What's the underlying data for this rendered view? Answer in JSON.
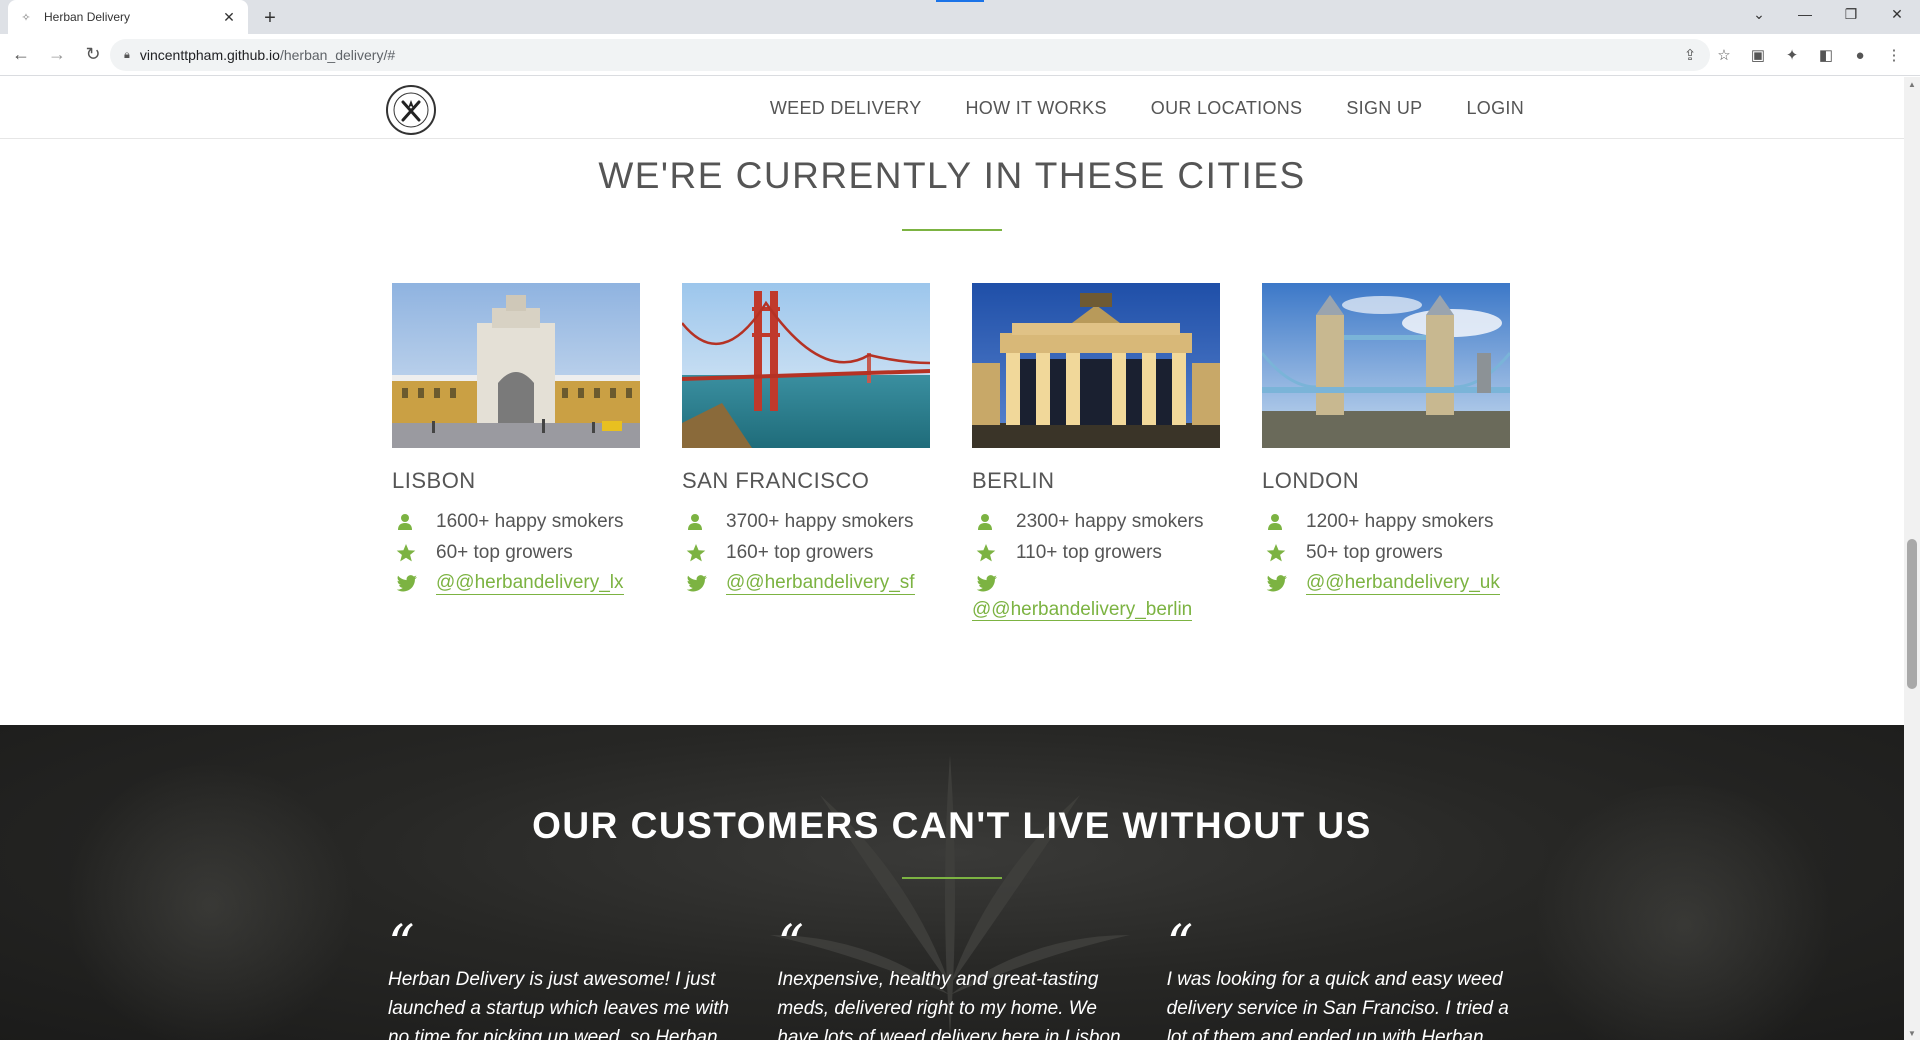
{
  "browser": {
    "tab_title": "Herban Delivery",
    "url_host": "vincenttpham.github.io",
    "url_path": "/herban_delivery/#"
  },
  "nav": {
    "links": [
      "WEED DELIVERY",
      "HOW IT WORKS",
      "OUR LOCATIONS",
      "SIGN UP",
      "LOGIN"
    ]
  },
  "cities_section": {
    "title": "WE'RE CURRENTLY IN THESE CITIES",
    "cities": [
      {
        "name": "LISBON",
        "smokers": "1600+ happy smokers",
        "growers": "60+ top growers",
        "twitter": "@@herbandelivery_lx"
      },
      {
        "name": "SAN FRANCISCO",
        "smokers": "3700+ happy smokers",
        "growers": "160+ top growers",
        "twitter": "@@herbandelivery_sf"
      },
      {
        "name": "BERLIN",
        "smokers": "2300+ happy smokers",
        "growers": "110+ top growers",
        "twitter": "@@herbandelivery_berlin"
      },
      {
        "name": "LONDON",
        "smokers": "1200+ happy smokers",
        "growers": "50+ top growers",
        "twitter": "@@herbandelivery_uk"
      }
    ]
  },
  "testimonials": {
    "title": "OUR CUSTOMERS CAN'T LIVE WITHOUT US",
    "quote_mark": "“",
    "quotes": [
      "Herban Delivery is just awesome! I just launched a startup which leaves me with no time for picking up weed, so Herban Delivery",
      "Inexpensive, healthy and great-tasting meds, delivered right to my home. We have lots of weed delivery here in Lisbon, but no one",
      "I was looking for a quick and easy weed delivery service in San Franciso. I tried a lot of them and ended up with Herban Delivery"
    ]
  },
  "colors": {
    "accent": "#7cb342",
    "text": "#555555",
    "dark_bg": "#222220"
  }
}
